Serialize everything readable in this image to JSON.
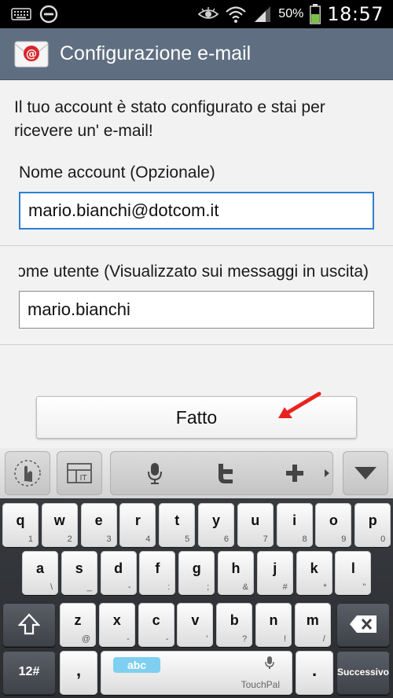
{
  "status_bar": {
    "battery": "50%",
    "time": "18:57",
    "icons": [
      "keyboard-icon",
      "do-not-disturb-icon",
      "eye-icon",
      "wifi-icon",
      "signal-icon",
      "battery-icon"
    ]
  },
  "action_bar": {
    "title": "Configurazione e-mail",
    "icon": "email-app-icon"
  },
  "content": {
    "message": "Il tuo account è stato configurato e stai per ricevere un' e-mail!",
    "account_name_label": "Nome account (Opzionale)",
    "account_name_value": "mario.bianchi@dotcom.it",
    "user_name_label": "Nome utente (Visualizzato sui messaggi in uscita)",
    "user_name_value": "mario.bianchi",
    "done_button": "Fatto"
  },
  "keyboard": {
    "row1": [
      {
        "key": "q",
        "sub": "1"
      },
      {
        "key": "w",
        "sub": "2"
      },
      {
        "key": "e",
        "sub": "3"
      },
      {
        "key": "r",
        "sub": "4"
      },
      {
        "key": "t",
        "sub": "5"
      },
      {
        "key": "y",
        "sub": "6"
      },
      {
        "key": "u",
        "sub": "7"
      },
      {
        "key": "i",
        "sub": "8"
      },
      {
        "key": "o",
        "sub": "9"
      },
      {
        "key": "p",
        "sub": "0"
      }
    ],
    "row2": [
      {
        "key": "a",
        "sub": "\\"
      },
      {
        "key": "s",
        "sub": "_"
      },
      {
        "key": "d",
        "sub": "-"
      },
      {
        "key": "f",
        "sub": ":"
      },
      {
        "key": "g",
        "sub": ";"
      },
      {
        "key": "h",
        "sub": "&"
      },
      {
        "key": "j",
        "sub": "#"
      },
      {
        "key": "k",
        "sub": "*"
      },
      {
        "key": "l",
        "sub": "\""
      }
    ],
    "row3": [
      {
        "key": "z",
        "sub": "@"
      },
      {
        "key": "x",
        "sub": "-"
      },
      {
        "key": "c",
        "sub": "-"
      },
      {
        "key": "v",
        "sub": "'"
      },
      {
        "key": "b",
        "sub": "?"
      },
      {
        "key": "n",
        "sub": "!"
      },
      {
        "key": "m",
        "sub": "/"
      }
    ],
    "symbols_key": "12#",
    "comma_key": ",",
    "period_key": ".",
    "space_mode": "abc",
    "space_brand": "TouchPal",
    "enter_key": "Successivo"
  }
}
